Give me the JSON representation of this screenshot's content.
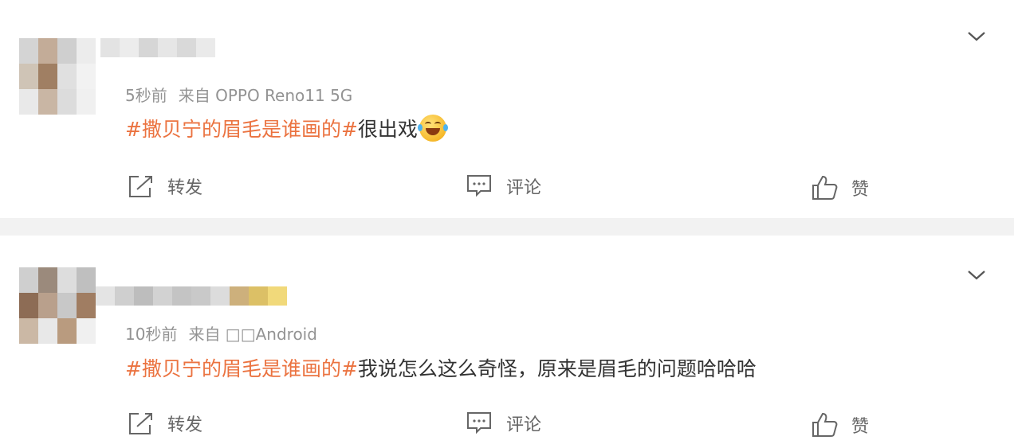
{
  "posts": [
    {
      "meta": {
        "time": "5秒前",
        "source": "来自 OPPO Reno11 5G"
      },
      "hashtag": "#撒贝宁的眉毛是谁画的#",
      "body": "很出戏",
      "emoji": "laughing-tears-emoji",
      "actions": {
        "repost": "转发",
        "comment": "评论",
        "like": "赞"
      },
      "avatar_colors": [
        "#d4d4d4",
        "#c3ac98",
        "#cfcfcf",
        "#ececec",
        "#cfc4b6",
        "#a07f63",
        "#e0e0e0",
        "#f2f2f2",
        "#e9e9e9",
        "#c9b6a4",
        "#dcdcdc",
        "#f0f0f0"
      ],
      "name_colors": [
        "#e3e3e3",
        "#ececec",
        "#d6d6d6",
        "#e6e6e6",
        "#d9d9d9",
        "#eaeaea"
      ]
    },
    {
      "meta": {
        "time": "10秒前",
        "source": "来自 □□Android"
      },
      "hashtag": "#撒贝宁的眉毛是谁画的#",
      "body": "我说怎么这么奇怪，原来是眉毛的问题哈哈哈",
      "actions": {
        "repost": "转发",
        "comment": "评论",
        "like": "赞"
      },
      "avatar_colors": [
        "#cfcfcf",
        "#9b8a7c",
        "#dddddd",
        "#bfbfbf",
        "#8d6c55",
        "#b9a08c",
        "#c8c8c8",
        "#a07d62",
        "#cbb8a5",
        "#e8e8e8",
        "#b99b7f",
        "#f0f0f0"
      ],
      "name_colors": [
        "#e4e4e4",
        "#cfcfcf",
        "#bdbdbd",
        "#d2d2d2",
        "#c4c4c4",
        "#c9c9c9",
        "#dcdcdc",
        "#cdb07c",
        "#dcc066",
        "#f1d97a"
      ]
    }
  ]
}
